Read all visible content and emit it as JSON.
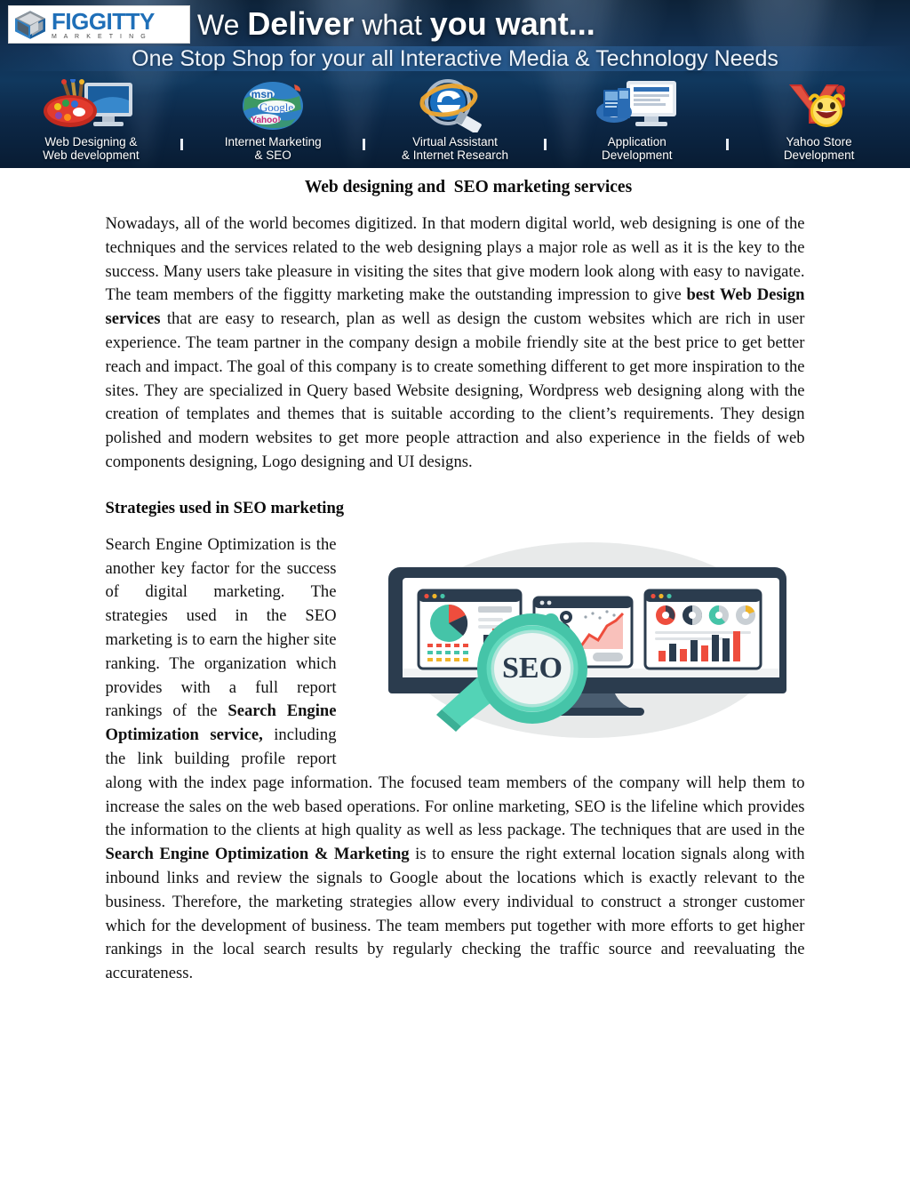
{
  "banner": {
    "logo": {
      "name": "FIGGITTY",
      "tagline": "M A R K E T I N G",
      "icon": "hexagon-cube-logo"
    },
    "headline_part1": "We ",
    "headline_part2": "Deliver",
    "headline_part3": " what ",
    "headline_part4": "you want...",
    "subheadline": "One Stop Shop for your all Interactive Media & Technology Needs",
    "services": [
      {
        "label": "Web Designing &\nWeb development",
        "icon": "paint-palette-monitor-icon"
      },
      {
        "label": "Internet Marketing\n& SEO",
        "icon": "search-engines-globe-icon"
      },
      {
        "label": "Virtual Assistant\n& Internet Research",
        "icon": "browser-magnifier-icon"
      },
      {
        "label": "Application\nDevelopment",
        "icon": "monitor-software-box-icon"
      },
      {
        "label": "Yahoo Store\nDevelopment",
        "icon": "yahoo-smiley-icon"
      }
    ],
    "colors": {
      "background_dark": "#0d2238",
      "background_mid": "#10385e",
      "logo_blue": "#1f6fb8",
      "text_white": "#ffffff"
    }
  },
  "document": {
    "title": "Web designing and  SEO marketing services",
    "paragraph1_a": "Nowadays, all of the world becomes digitized. In that modern digital world, web designing is one of the techniques and the services related to the web designing plays a major role as well as it is the key to the success. Many users take pleasure in visiting the sites that give modern look along with easy to navigate. The team members of the figgitty marketing make the outstanding impression to give ",
    "paragraph1_bold": "best Web Design services",
    "paragraph1_b": "  that are easy to research, plan as well as design the custom websites which are rich in user experience. The team partner in the company design a mobile friendly site at the  best price to get better reach and impact. The goal of this company is to create something different to get more inspiration to the sites. They are specialized in Query based Website designing, Wordpress web designing along with the creation of  templates and themes that is suitable according to the client’s requirements. They design polished and modern websites to get more people attraction and also experience in the fields of web components designing, Logo designing and UI designs.",
    "subheading": "Strategies used in SEO marketing",
    "paragraph2_a": "Search Engine Optimization is the another key factor for the success of digital marketing. The strategies used in the SEO marketing is to earn the higher site ranking. The organization which provides with a full report rankings of the ",
    "paragraph2_bold": "Search Engine Optimization service,",
    "paragraph2_b": " including the link building profile report  along with the index page information. The focused team members of the company will help them to increase the sales on the web based operations. For online marketing, SEO is the lifeline which provides the information to the clients at high quality as well as less package. The techniques that are used in the ",
    "paragraph2_bold2": "Search Engine Optimization & Marketing",
    "paragraph2_c": " is to ensure the right external location signals along with inbound links and review the signals to Google about the locations which is exactly relevant to the business. Therefore, the marketing strategies allow every individual to construct a stronger customer which for the development of business. The team members put together with more efforts to get higher rankings in the local search results by regularly checking the traffic source and reevaluating the accurateness."
  },
  "illustration": {
    "alt_name": "seo-monitor-magnifier-illustration",
    "magnifier_label": "SEO",
    "colors": {
      "monitor_frame": "#2b3c4e",
      "teal": "#45c4a8",
      "red": "#ee4d3d",
      "dark": "#2b3c4e",
      "backdrop": "#e8eaea"
    }
  }
}
